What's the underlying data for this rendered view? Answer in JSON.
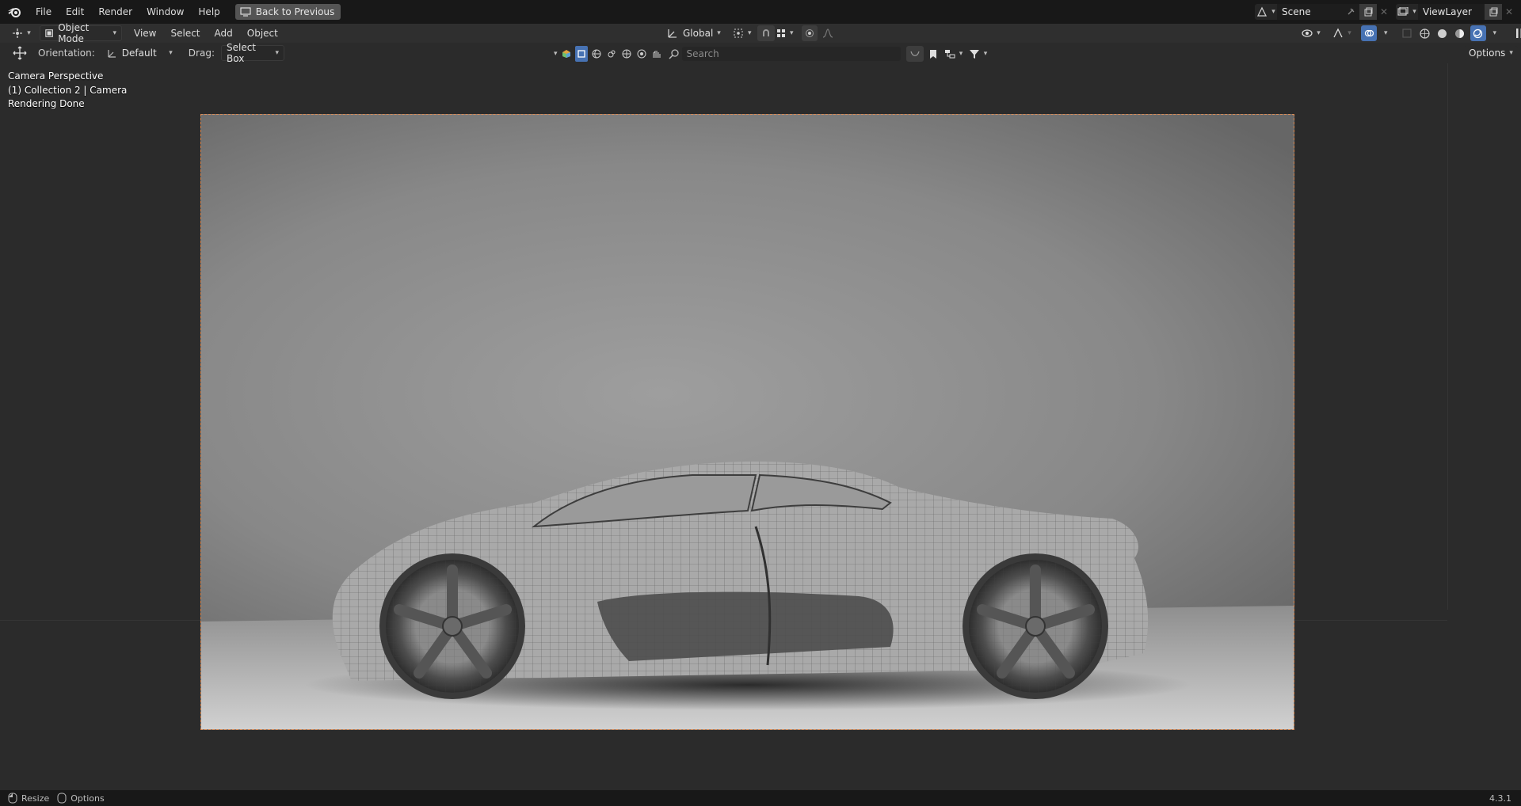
{
  "menu": {
    "items": [
      "File",
      "Edit",
      "Render",
      "Window",
      "Help"
    ],
    "back_button": "Back to Previous"
  },
  "scene": {
    "name": "Scene"
  },
  "view_layer": {
    "name": "ViewLayer"
  },
  "header": {
    "mode": "Object Mode",
    "view": "View",
    "select": "Select",
    "add": "Add",
    "object": "Object",
    "transform_orientation": "Global"
  },
  "toolbar": {
    "orientation_label": "Orientation:",
    "orientation_value": "Default",
    "drag_label": "Drag:",
    "drag_value": "Select Box",
    "search_placeholder": "Search",
    "options_label": "Options"
  },
  "viewport": {
    "line1": "Camera Perspective",
    "line2": "(1) Collection 2 | Camera",
    "line3": "Rendering Done"
  },
  "status": {
    "resize": "Resize",
    "options": "Options",
    "version": "4.3.1"
  },
  "colors": {
    "accent": "#4772b3",
    "frame_border": "#d88a55"
  }
}
